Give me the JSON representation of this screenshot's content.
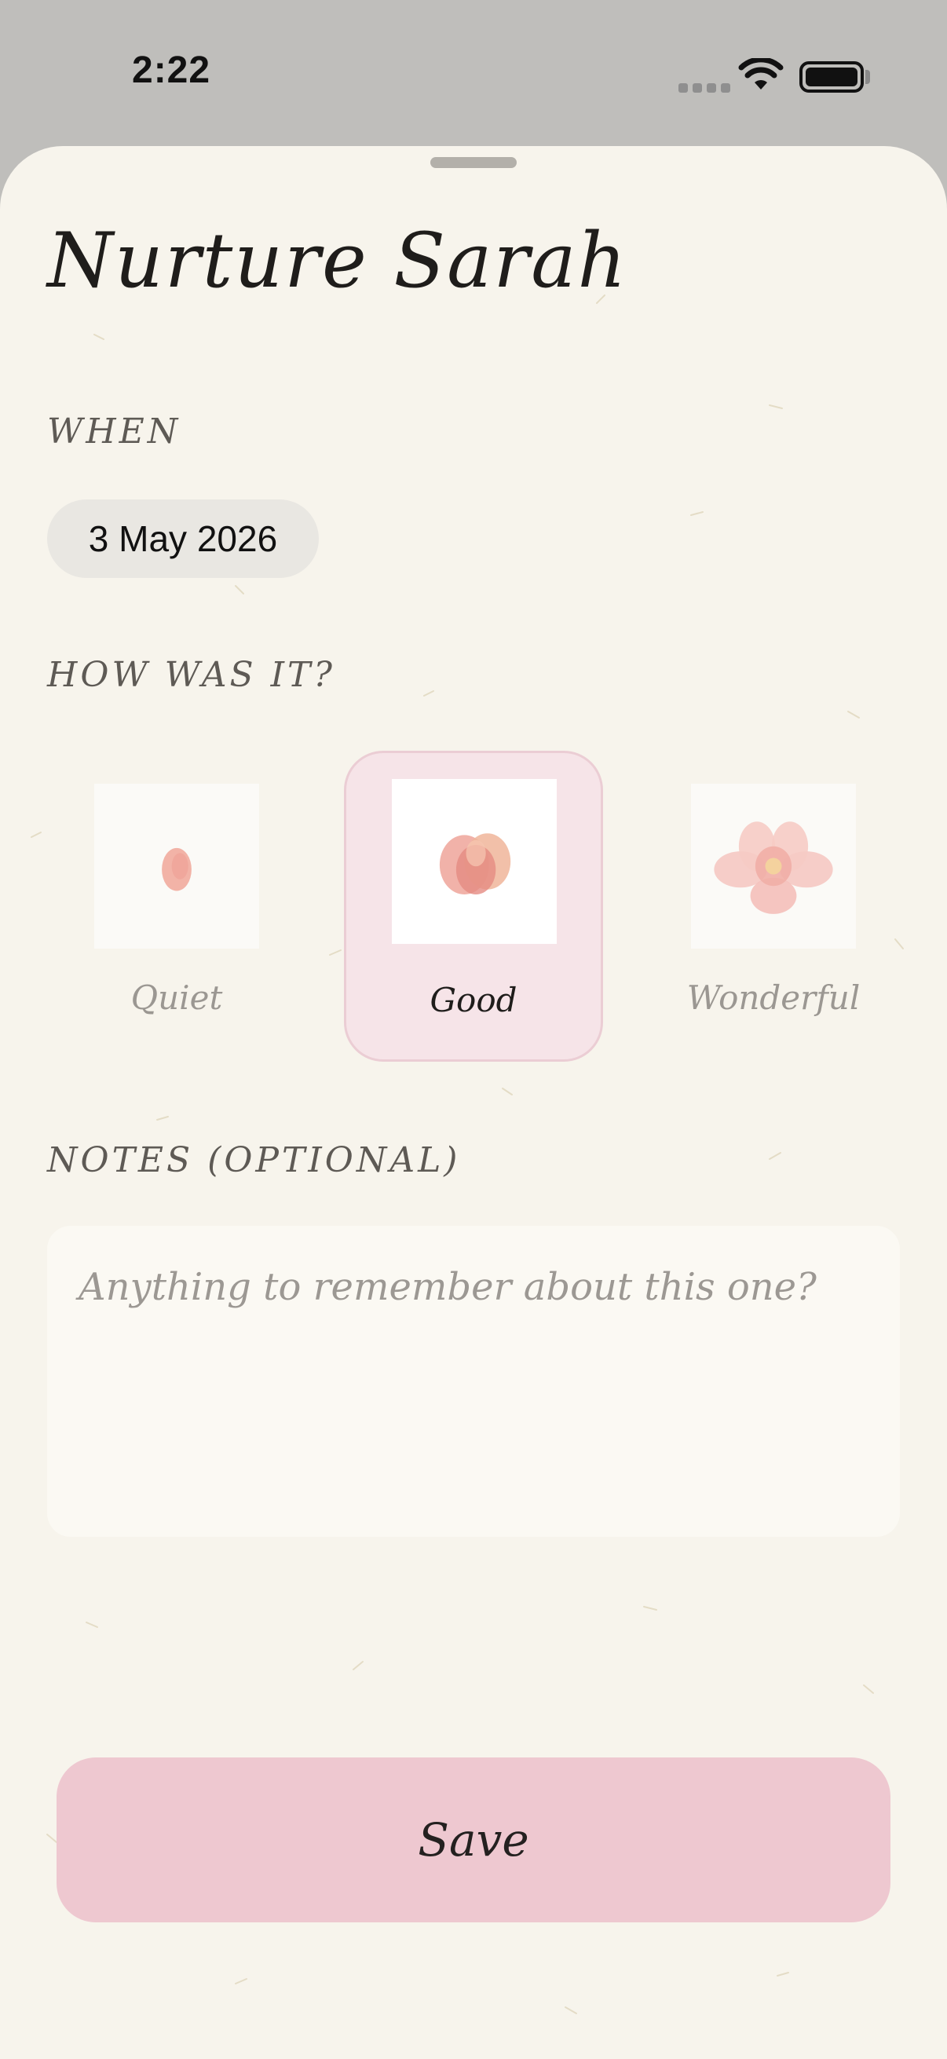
{
  "status_bar": {
    "time": "2:22",
    "icons": [
      "cellular-icon",
      "wifi-icon",
      "battery-icon"
    ]
  },
  "sheet": {
    "title": "Nurture Sarah"
  },
  "when": {
    "label": "WHEN",
    "date": "3 May 2026"
  },
  "rating": {
    "label": "HOW WAS IT?",
    "options": [
      {
        "label": "Quiet",
        "icon": "petal-icon",
        "selected": false
      },
      {
        "label": "Good",
        "icon": "bud-icon",
        "selected": true
      },
      {
        "label": "Wonderful",
        "icon": "bloom-icon",
        "selected": false
      }
    ]
  },
  "notes": {
    "label": "NOTES (OPTIONAL)",
    "placeholder": "Anything to remember about this one?",
    "value": ""
  },
  "actions": {
    "save_label": "Save"
  },
  "colors": {
    "sheet_bg": "#f7f4ec",
    "selected_bg": "#f6e4e8",
    "save_bg": "#eec8d0",
    "petal_pink": "#ef9f95"
  }
}
